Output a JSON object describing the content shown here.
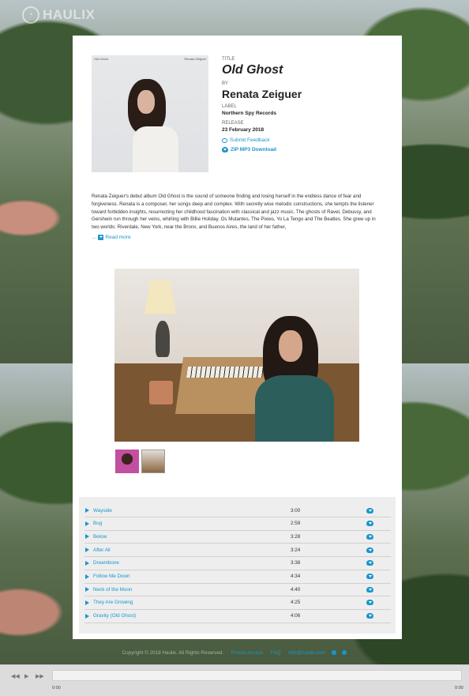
{
  "brand": {
    "name": "HAULIX"
  },
  "album": {
    "title_label": "TITLE",
    "title": "Old Ghost",
    "by_label": "BY",
    "artist": "Renata Zeiguer",
    "label_label": "LABEL",
    "label": "Northern Spy Records",
    "release_label": "RELEASE",
    "release_date": "23 February 2018",
    "cover_title": "Old Ghost",
    "cover_artist": "Renata Zeiguer"
  },
  "actions": {
    "feedback": "Submit Feedback",
    "download": "ZIP MP3 Download"
  },
  "description": "Renata Zeiguer's debut album Old Ghost is the sound of someone finding and losing herself in the endless dance of fear and forgiveness. Renata is a composer, her songs deep and complex. With secretly wise melodic constructions, she tempts the listener toward forbidden insights, resurrecting her childhood fascination with classical and jazz music. The ghosts of Ravel, Debussy, and Gershwin run through her veins, whirling with Billie Holiday, Os Mutantes, The Pixies, Yo La Tengo and The Beatles. She grew up in two worlds: Riverdale, New York, near the Bronx, and Buenos Aires, the land of her father,",
  "read_more": {
    "prefix": "...",
    "label": "Read more"
  },
  "tracks": [
    {
      "name": "Wayside",
      "duration": "3:00"
    },
    {
      "name": "Bug",
      "duration": "2:59"
    },
    {
      "name": "Below",
      "duration": "3:28"
    },
    {
      "name": "After All",
      "duration": "3:24"
    },
    {
      "name": "Dreambone",
      "duration": "3:38"
    },
    {
      "name": "Follow Me Down",
      "duration": "4:34"
    },
    {
      "name": "Neck of the Moon",
      "duration": "4:40"
    },
    {
      "name": "They Are Growing",
      "duration": "4:25"
    },
    {
      "name": "Gravity (Old Ghost)",
      "duration": "4:06"
    }
  ],
  "footer": {
    "copyright": "Copyright © 2018 Haulix. All Rights Reserved.",
    "links": [
      "Promo Access",
      "FAQ",
      "info@haulix.com"
    ]
  },
  "player": {
    "time_start": "0:00",
    "time_end": "0:00"
  },
  "colors": {
    "accent": "#1a95cc",
    "card": "#ffffff",
    "tracklist_bg": "#eeeeee"
  }
}
